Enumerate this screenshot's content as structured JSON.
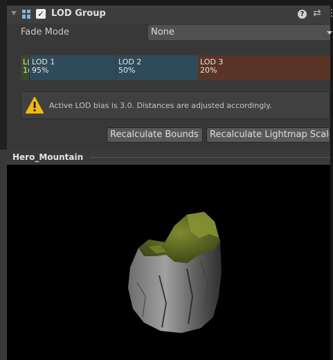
{
  "component": {
    "title": "LOD Group",
    "enabled": true,
    "icons": [
      "foldout-arrow-icon",
      "lod-group-icon",
      "help-icon",
      "preset-icon",
      "more-icon"
    ]
  },
  "fade_mode": {
    "label": "Fade Mode",
    "value": "None"
  },
  "lod_levels": [
    {
      "name": "L(",
      "percent": "1(",
      "color": "#3b4a2a"
    },
    {
      "name": "LOD 1",
      "percent": "95%",
      "color": "#2f4a5a"
    },
    {
      "name": "LOD 2",
      "percent": "50%",
      "color": "#2f4a5a"
    },
    {
      "name": "LOD 3",
      "percent": "20%",
      "color": "#5a3426"
    }
  ],
  "warning": {
    "text": "Active LOD bias is 3.0. Distances are adjusted accordingly."
  },
  "buttons": {
    "recalculate_bounds": "Recalculate Bounds",
    "recalculate_lightmap": "Recalculate Lightmap Scale"
  },
  "preview": {
    "title": "Hero_Mountain"
  }
}
